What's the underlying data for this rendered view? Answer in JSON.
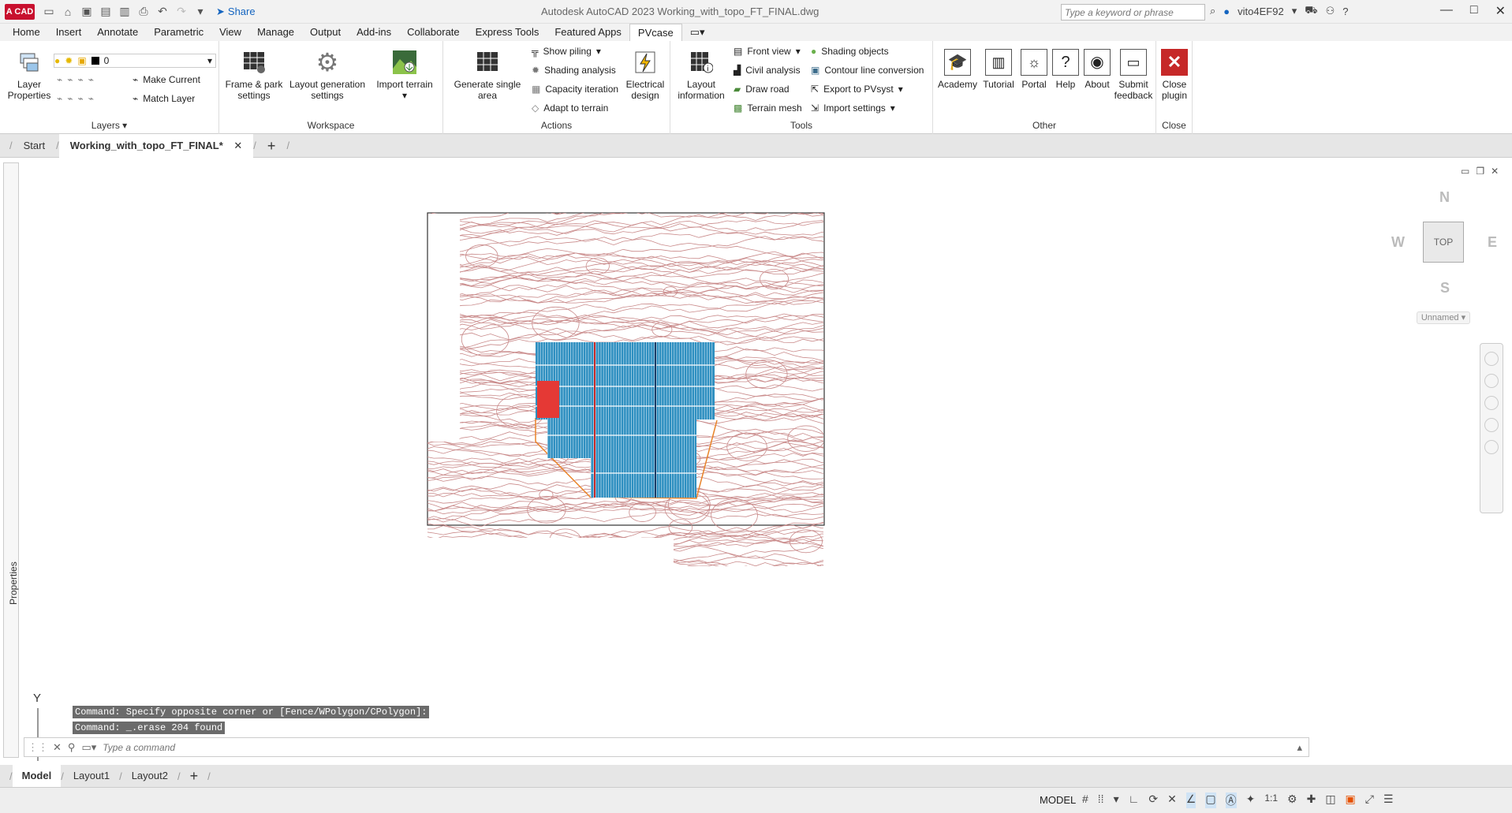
{
  "titlebar": {
    "logo": "A CAD",
    "share": "Share",
    "title": "Autodesk AutoCAD 2023    Working_with_topo_FT_FINAL.dwg",
    "search_placeholder": "Type a keyword or phrase",
    "user": "vito4EF92"
  },
  "menu": {
    "tabs": [
      "Home",
      "Insert",
      "Annotate",
      "Parametric",
      "View",
      "Manage",
      "Output",
      "Add-ins",
      "Collaborate",
      "Express Tools",
      "Featured Apps",
      "PVcase"
    ]
  },
  "ribbon": {
    "layers": {
      "layer_properties": "Layer Properties",
      "layer_value": "0",
      "make_current": "Make Current",
      "match_layer": "Match Layer",
      "title": "Layers"
    },
    "workspace": {
      "frame_park": "Frame & park settings",
      "layout_generation": "Layout generation settings",
      "import_terrain": "Import terrain",
      "title": "Workspace"
    },
    "actions": {
      "generate_single": "Generate single area",
      "show_piling": "Show piling",
      "shading_analysis": "Shading analysis",
      "capacity_iteration": "Capacity iteration",
      "adapt_terrain": "Adapt to terrain",
      "electrical_design": "Electrical design",
      "title": "Actions"
    },
    "tools": {
      "layout_information": "Layout information",
      "front_view": "Front view",
      "civil_analysis": "Civil analysis",
      "draw_road": "Draw road",
      "terrain_mesh": "Terrain mesh",
      "shading_objects": "Shading objects",
      "contour_conversion": "Contour line conversion",
      "export_pvsyst": "Export to PVsyst",
      "import_settings": "Import settings",
      "title": "Tools"
    },
    "other": {
      "academy": "Academy",
      "tutorial": "Tutorial",
      "portal": "Portal",
      "help": "Help",
      "about": "About",
      "submit_feedback": "Submit feedback",
      "title": "Other"
    },
    "close": {
      "close_plugin": "Close plugin",
      "title": "Close"
    }
  },
  "doctabs": {
    "start": "Start",
    "file": "Working_with_topo_FT_FINAL*"
  },
  "properties_label": "Properties",
  "viewcube": {
    "n": "N",
    "s": "S",
    "e": "E",
    "w": "W",
    "top": "TOP",
    "unnamed": "Unnamed"
  },
  "command": {
    "line1": "Command: Specify opposite corner or [Fence/WPolygon/CPolygon]:",
    "line2": "Command: _.erase 204 found",
    "placeholder": "Type a command"
  },
  "axis": {
    "y": "Y"
  },
  "layouts": {
    "tabs": [
      "Model",
      "Layout1",
      "Layout2"
    ]
  },
  "status": {
    "model": "MODEL",
    "scale": "1:1"
  },
  "colors": {
    "contour": "#c98a8a",
    "panels": "#2e8fc0",
    "accent": "#c8102e"
  }
}
